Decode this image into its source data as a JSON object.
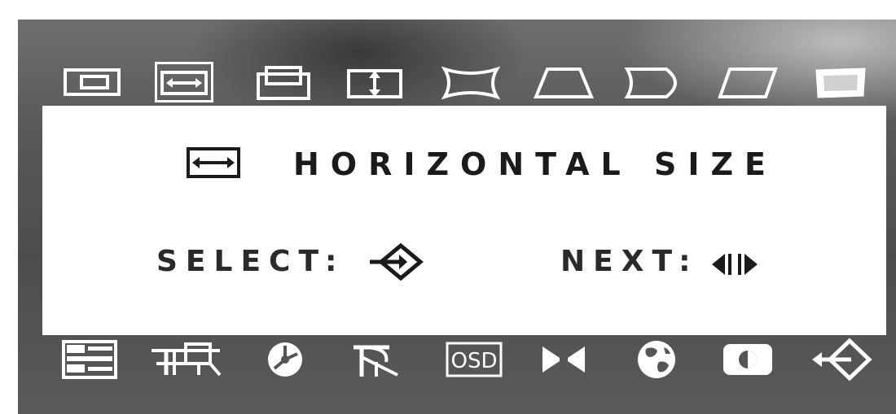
{
  "osd_menu": {
    "top_icons": [
      {
        "name": "horizontal-position-icon",
        "selected": false
      },
      {
        "name": "horizontal-size-icon",
        "selected": true
      },
      {
        "name": "vertical-position-icon",
        "selected": false
      },
      {
        "name": "vertical-size-icon",
        "selected": false
      },
      {
        "name": "pincushion-icon",
        "selected": false
      },
      {
        "name": "trapezoid-icon",
        "selected": false
      },
      {
        "name": "pin-balance-icon",
        "selected": false
      },
      {
        "name": "parallelogram-icon",
        "selected": false
      },
      {
        "name": "rotation-icon",
        "selected": false
      }
    ],
    "info": {
      "title": "HORIZONTAL SIZE",
      "select_label": "SELECT:",
      "next_label": "NEXT:"
    },
    "bottom_icons": [
      {
        "name": "menu-list-icon"
      },
      {
        "name": "convergence-icon"
      },
      {
        "name": "degauss-icon"
      },
      {
        "name": "moire-icon"
      },
      {
        "name": "osd-icon",
        "text": "OSD"
      },
      {
        "name": "recall-icon"
      },
      {
        "name": "language-icon"
      },
      {
        "name": "contrast-icon"
      },
      {
        "name": "exit-icon"
      }
    ]
  }
}
